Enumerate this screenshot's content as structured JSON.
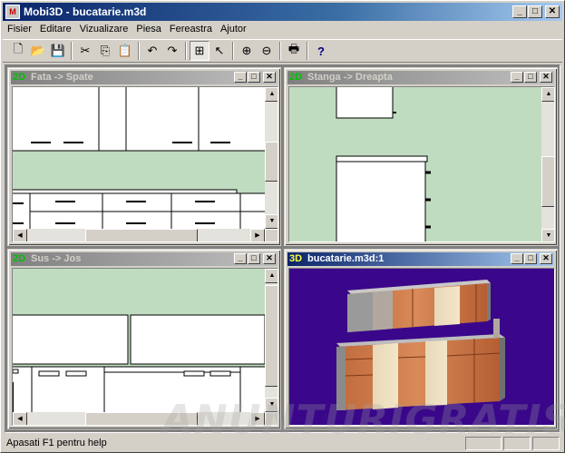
{
  "window": {
    "title": "Mobi3D - bucatarie.m3d",
    "app_icon_text": "M"
  },
  "menu": [
    "Fisier",
    "Editare",
    "Vizualizare",
    "Piesa",
    "Fereastra",
    "Ajutor"
  ],
  "toolbar": [
    {
      "name": "new-document-icon",
      "glyph": "🗋"
    },
    {
      "name": "open-folder-icon",
      "glyph": "📂"
    },
    {
      "name": "save-icon",
      "glyph": "💾"
    },
    {
      "name": "cut-icon",
      "glyph": "✂"
    },
    {
      "name": "copy-icon",
      "glyph": "⎘"
    },
    {
      "name": "paste-icon",
      "glyph": "📋"
    },
    {
      "name": "undo-icon",
      "glyph": "↶"
    },
    {
      "name": "redo-icon",
      "glyph": "↷"
    },
    {
      "name": "add-piece-icon",
      "glyph": "⊞"
    },
    {
      "name": "select-pointer-icon",
      "glyph": "↖"
    },
    {
      "name": "zoom-in-icon",
      "glyph": "⊕"
    },
    {
      "name": "zoom-out-icon",
      "glyph": "⊖"
    },
    {
      "name": "print-icon",
      "glyph": "🖶"
    },
    {
      "name": "help-icon",
      "glyph": "?"
    }
  ],
  "views": {
    "front": {
      "tag": "2D",
      "title": "Fata -> Spate"
    },
    "side": {
      "tag": "2D",
      "title": "Stanga -> Dreapta"
    },
    "top": {
      "tag": "2D",
      "title": "Sus -> Jos"
    },
    "perspective": {
      "tag": "3D",
      "title": "bucatarie.m3d:1"
    }
  },
  "window_buttons": {
    "minimize": "_",
    "maximize": "□",
    "close": "✕"
  },
  "status": {
    "text": "Apasati  F1 pentru help"
  },
  "watermark": "ANUNTURIGRATIS.NET",
  "colors": {
    "view_bg": "#c0dcc0",
    "view3d_bg": "#3a078a",
    "title_active": "#0a246a",
    "title_inactive": "#808080"
  }
}
